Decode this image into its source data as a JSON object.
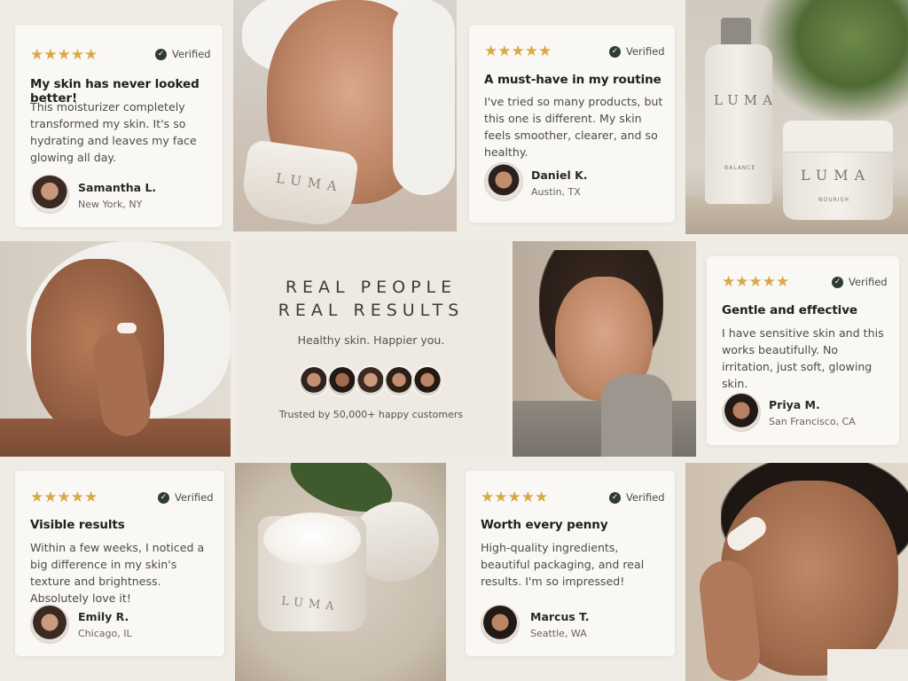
{
  "reviews": [
    {
      "stars": "★★★★★",
      "verified": "Verified",
      "title": "My skin has never looked better!",
      "body": "This moisturizer completely transformed my skin. It's so hydrating and leaves my face glowing all day.",
      "name": "Samantha L.",
      "location": "New York, NY"
    },
    {
      "stars": "★★★★★",
      "verified": "Verified",
      "title": "A must-have in my routine",
      "body": "I've tried so many products, but this one is different. My skin feels smoother, clearer, and so healthy.",
      "name": "Daniel K.",
      "location": "Austin, TX"
    },
    {
      "stars": "★★★★★",
      "verified": "Verified",
      "title": "Gentle and effective",
      "body": "I have sensitive skin and this works beautifully. No irritation, just soft, glowing skin.",
      "name": "Priya M.",
      "location": "San Francisco, CA"
    },
    {
      "stars": "★★★★★",
      "verified": "Verified",
      "title": "Visible results",
      "body": "Within a few weeks, I noticed a big difference in my skin's texture and brightness. Absolutely love it!",
      "name": "Emily R.",
      "location": "Chicago, IL"
    },
    {
      "stars": "★★★★★",
      "verified": "Verified",
      "title": "Worth every penny",
      "body": "High-quality ingredients, beautiful packaging, and real results. I'm so impressed!",
      "name": "Marcus T.",
      "location": "Seattle, WA"
    }
  ],
  "hero": {
    "line1": "REAL PEOPLE",
    "line2": "REAL RESULTS",
    "tagline": "Healthy skin. Happier you.",
    "trusted": "Trusted by 50,000+ happy customers"
  },
  "brand": {
    "jar_label": "LUMA",
    "bottle_label": "LUMA",
    "bottle_sub": "BALANCE",
    "cream_label": "LUMA",
    "cream_sub": "NOURISH",
    "jar2_label": "LUMA"
  },
  "colors": {
    "star": "#d9a847",
    "verified_check": "#2f3a35",
    "card": "#faf8f5",
    "page": "#efebe5"
  },
  "icons": [
    "star-icon",
    "check-circle-icon"
  ]
}
